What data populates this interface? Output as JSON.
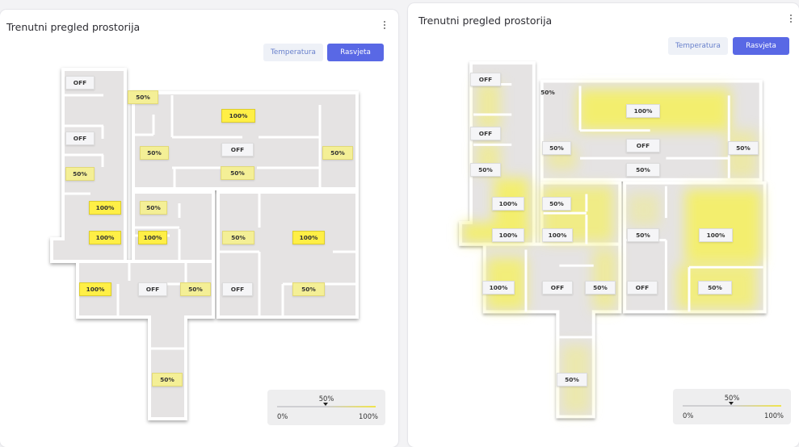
{
  "panels": [
    {
      "title": "Trenutni pregled prostorija",
      "buttons": {
        "temperature": "Temperatura",
        "lighting": "Rasvjeta"
      },
      "legend": {
        "mid": "50%",
        "min": "0%",
        "max": "100%",
        "marker_value": 50
      },
      "rooms": [
        "OFF",
        "50%",
        "100%",
        "OFF",
        "50%",
        "OFF",
        "50%",
        "50%",
        "50%",
        "100%",
        "50%",
        "100%",
        "100%",
        "100%",
        "50%",
        "100%",
        "100%",
        "OFF",
        "50%",
        "OFF",
        "50%",
        "50%"
      ]
    },
    {
      "title": "Trenutni pregled prostorija",
      "buttons": {
        "temperature": "Temperatura",
        "lighting": "Rasvjeta"
      },
      "legend": {
        "mid": "50%",
        "min": "0%",
        "max": "100%",
        "marker_value": 50
      },
      "rooms": [
        "OFF",
        "50%",
        "100%",
        "OFF",
        "50%",
        "OFF",
        "50%",
        "50%",
        "50%",
        "100%",
        "50%",
        "100%",
        "100%",
        "100%",
        "50%",
        "100%",
        "100%",
        "OFF",
        "50%",
        "OFF",
        "50%",
        "50%"
      ]
    }
  ],
  "colors": {
    "accent": "#5968e5",
    "light_full": "#ffef46",
    "light_half": "#f4ef96",
    "glow": "#f2ec6a"
  }
}
